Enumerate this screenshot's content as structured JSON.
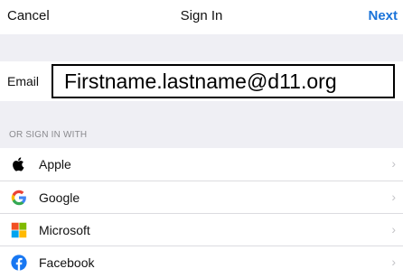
{
  "nav": {
    "cancel_label": "Cancel",
    "title": "Sign In",
    "next_label": "Next",
    "next_color": "#1a73d9"
  },
  "email": {
    "label": "Email",
    "value": "Firstname.lastname@d11.org"
  },
  "section": {
    "label": "OR SIGN IN WITH"
  },
  "providers": [
    {
      "label": "Apple",
      "icon": "apple-icon"
    },
    {
      "label": "Google",
      "icon": "google-icon"
    },
    {
      "label": "Microsoft",
      "icon": "microsoft-icon"
    },
    {
      "label": "Facebook",
      "icon": "facebook-icon"
    }
  ],
  "colors": {
    "background_gray": "#efeff4",
    "chevron": "#c4c4c8"
  }
}
